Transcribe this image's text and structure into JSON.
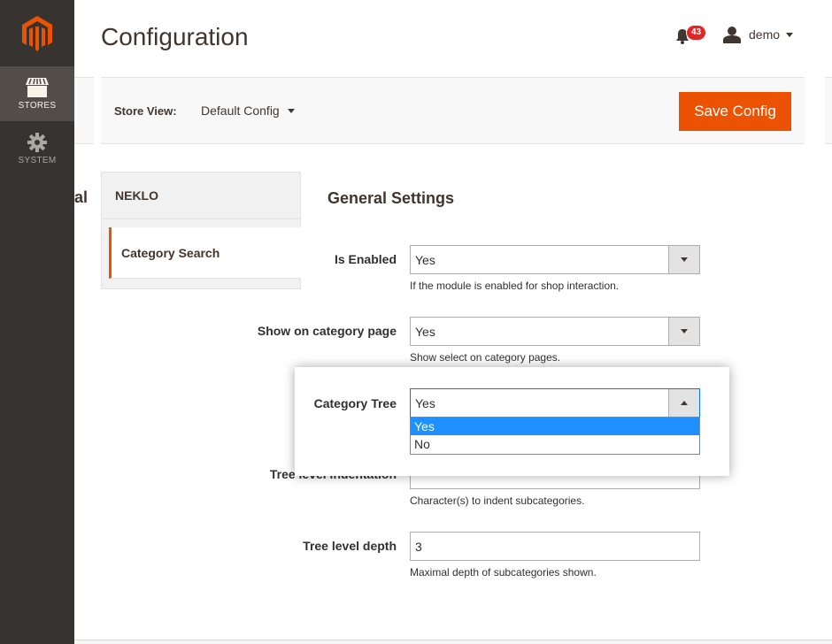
{
  "sidebar": {
    "logo": "magento-logo",
    "items": [
      {
        "label": "STORES",
        "icon": "store-icon",
        "active": true
      },
      {
        "label": "SYSTEM",
        "icon": "gear-icon",
        "active": false
      }
    ]
  },
  "header": {
    "title": "Configuration",
    "notifications_count": "43",
    "user_name": "demo"
  },
  "store_bar": {
    "label": "Store View:",
    "selected": "Default Config",
    "save_label": "Save Config"
  },
  "config_nav": {
    "cut_text": "al S",
    "group_title": "NEKLO",
    "items": [
      {
        "label": "Category Search",
        "active": true
      }
    ]
  },
  "form": {
    "section_title": "General Settings",
    "fields": {
      "is_enabled": {
        "label": "Is Enabled",
        "value": "Yes",
        "note": "If the module is enabled for shop interaction."
      },
      "show_on_category": {
        "label": "Show on category page",
        "value": "Yes",
        "note": "Show select on category pages."
      },
      "category_tree": {
        "label": "Category Tree",
        "value": "Yes",
        "options": [
          "Yes",
          "No"
        ],
        "highlighted": "Yes"
      },
      "tree_indentation": {
        "label": "Tree level indentation",
        "value": "",
        "note": "Character(s) to indent subcategories."
      },
      "tree_depth": {
        "label": "Tree level depth",
        "value": "3",
        "note": "Maximal depth of subcategories shown."
      }
    }
  },
  "colors": {
    "accent": "#eb5202",
    "sidebar_bg": "#373330",
    "sidebar_active": "#524d49",
    "badge": "#e22626",
    "dropdown_highlight": "#1e90ff"
  }
}
